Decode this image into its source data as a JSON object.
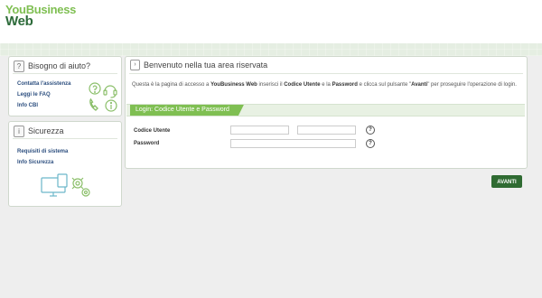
{
  "header": {
    "logo_line1": "YouBusiness",
    "logo_line2": "Web"
  },
  "help_panel": {
    "title": "Bisogno di aiuto?",
    "links": [
      "Contatta l'assistenza",
      "Leggi le FAQ",
      "Info CBI"
    ],
    "icons": [
      "question-bubble-icon",
      "headset-icon",
      "phone-icon",
      "info-icon"
    ]
  },
  "security_panel": {
    "title": "Sicurezza",
    "links": [
      "Requisiti di sistema",
      "Info Sicurezza"
    ],
    "icons": [
      "devices-gears-icon"
    ]
  },
  "main": {
    "title": "Benvenuto nella tua area riservata",
    "intro_1": "Questa è la pagina di accesso a ",
    "intro_brand": "YouBusiness Web",
    "intro_2": " inserisci il ",
    "intro_user": "Codice Utente",
    "intro_3": " e la ",
    "intro_pwd": "Password",
    "intro_4": " e clicca sul pulsante \"",
    "intro_btn": "Avanti",
    "intro_5": "\" per proseguire l'operazione di login.",
    "login_tab": "Login: Codice Utente e Password",
    "user_label": "Codice Utente",
    "password_label": "Password",
    "help_glyph": "?"
  },
  "actions": {
    "avanti": "AVANTI"
  },
  "colors": {
    "accent_green": "#7fbf52",
    "dark_green": "#2f6b32",
    "link_blue": "#2d4f7f"
  }
}
